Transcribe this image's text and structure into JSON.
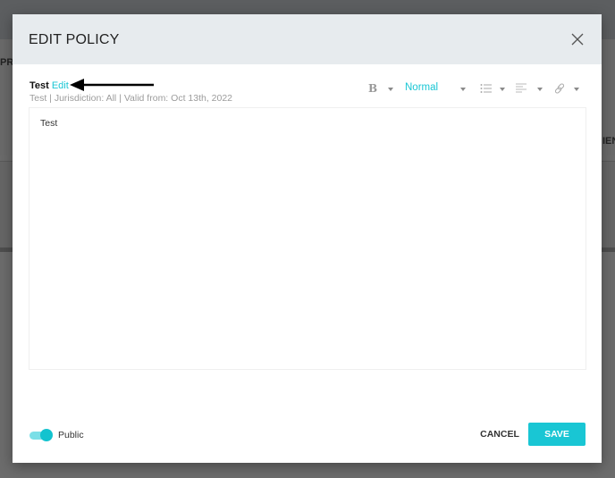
{
  "background": {
    "left_text": "PR",
    "right_text": "IEN"
  },
  "modal": {
    "title": "EDIT POLICY",
    "policy": {
      "name": "Test",
      "edit_link": "Edit",
      "meta": "Test | Jurisdiction: All | Valid from: Oct 13th, 2022"
    },
    "toolbar": {
      "bold_label": "B",
      "format_select": "Normal",
      "icons": [
        "bold-icon",
        "list-icon",
        "align-icon",
        "link-icon"
      ]
    },
    "editor": {
      "content": "Test"
    },
    "footer": {
      "public_label": "Public",
      "public_on": true,
      "cancel_label": "CANCEL",
      "save_label": "SAVE"
    },
    "colors": {
      "accent": "#19c6d4",
      "header_bg": "#e7ebee"
    }
  }
}
